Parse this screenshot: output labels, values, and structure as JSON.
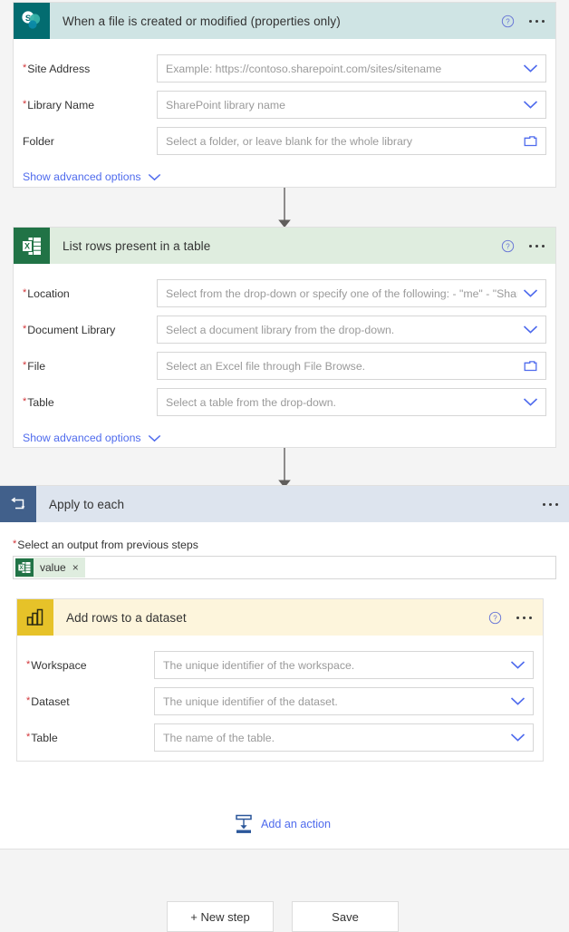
{
  "cards": [
    {
      "id": "sharepoint-trigger",
      "title": "When a file is created or modified (properties only)",
      "icon": "sharepoint-icon",
      "header_color": "#cfe4e4",
      "icon_bg": "#036c70",
      "help_label": "?",
      "menu_label": "more-commands",
      "fields": [
        {
          "label": "Site Address",
          "required": true,
          "placeholder": "Example: https://contoso.sharepoint.com/sites/sitename",
          "control": "dropdown"
        },
        {
          "label": "Library Name",
          "required": true,
          "placeholder": "SharePoint library name",
          "control": "dropdown"
        },
        {
          "label": "Folder",
          "required": false,
          "placeholder": "Select a folder, or leave blank for the whole library",
          "control": "folder"
        }
      ],
      "advanced_label": "Show advanced options"
    },
    {
      "id": "excel-list-rows",
      "title": "List rows present in a table",
      "icon": "excel-icon",
      "header_color": "#dfeddf",
      "icon_bg": "#217346",
      "help_label": "?",
      "menu_label": "more-commands",
      "fields": [
        {
          "label": "Location",
          "required": true,
          "placeholder": "Select from the drop-down or specify one of the following: - \"me\" - \"Shar",
          "control": "dropdown"
        },
        {
          "label": "Document Library",
          "required": true,
          "placeholder": "Select a document library from the drop-down.",
          "control": "dropdown"
        },
        {
          "label": "File",
          "required": true,
          "placeholder": "Select an Excel file through File Browse.",
          "control": "folder"
        },
        {
          "label": "Table",
          "required": true,
          "placeholder": "Select a table from the drop-down.",
          "control": "dropdown"
        }
      ],
      "advanced_label": "Show advanced options"
    }
  ],
  "apply_to_each": {
    "title": "Apply to each",
    "icon": "loop-icon",
    "header_color": "#dde4ee",
    "icon_bg": "#41608b",
    "menu_label": "more-commands",
    "output_label": "Select an output from previous steps",
    "output_required": true,
    "token": {
      "icon": "excel-icon",
      "text": "value",
      "remove_label": "×"
    },
    "nested_card": {
      "id": "powerbi-add-rows",
      "title": "Add rows to a dataset",
      "icon": "powerbi-icon",
      "header_color": "#fdf5dc",
      "icon_bg": "#e6c229",
      "help_label": "?",
      "menu_label": "more-commands",
      "fields": [
        {
          "label": "Workspace",
          "required": true,
          "placeholder": "The unique identifier of the workspace.",
          "control": "dropdown"
        },
        {
          "label": "Dataset",
          "required": true,
          "placeholder": "The unique identifier of the dataset.",
          "control": "dropdown"
        },
        {
          "label": "Table",
          "required": true,
          "placeholder": "The name of the table.",
          "control": "dropdown"
        }
      ]
    },
    "add_action": {
      "label": "Add an action",
      "icon": "insert-action-icon"
    }
  },
  "footer": {
    "new_step_label": "+ New step",
    "save_label": "Save"
  },
  "colors": {
    "accent_blue": "#4f6bed",
    "required_red": "#d13438",
    "placeholder_grey": "#9a9a9a",
    "canvas_bg": "#f4f4f4"
  }
}
